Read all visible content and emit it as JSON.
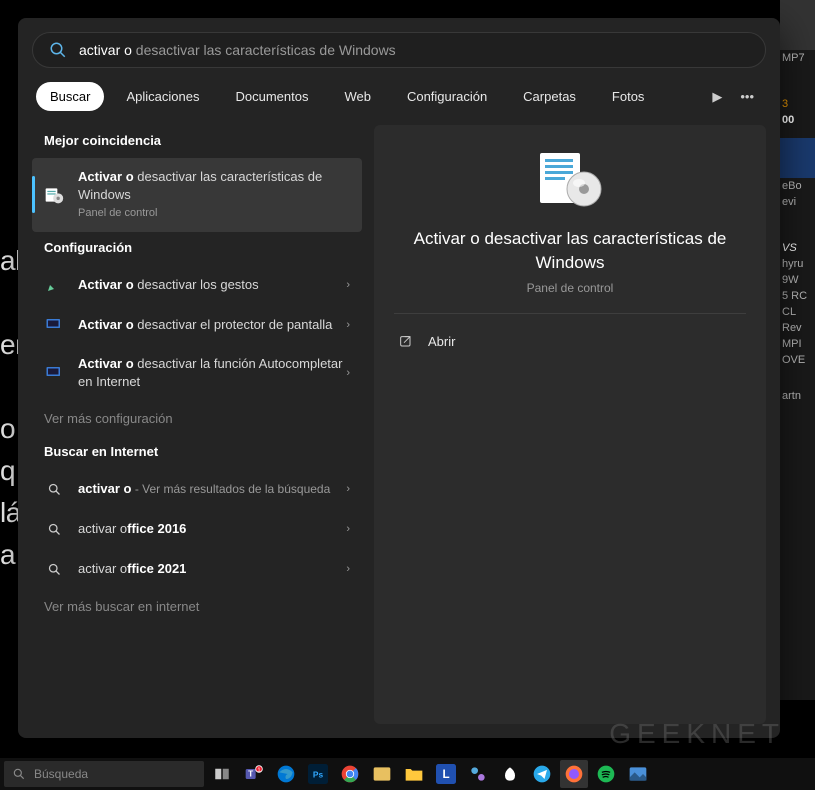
{
  "search": {
    "typed": "activar o",
    "hint": " desactivar las características de Windows"
  },
  "tabs": {
    "items": [
      "Buscar",
      "Aplicaciones",
      "Documentos",
      "Web",
      "Configuración",
      "Carpetas",
      "Fotos"
    ],
    "active": 0
  },
  "sections": {
    "best_match": "Mejor coincidencia",
    "configuration": "Configuración",
    "search_web": "Buscar en Internet"
  },
  "results": {
    "best": {
      "bold": "Activar o ",
      "rest": "desactivar las características de Windows",
      "sub": "Panel de control"
    },
    "config": [
      {
        "bold": "Activar o ",
        "rest": "desactivar los gestos"
      },
      {
        "bold": "Activar o ",
        "rest": "desactivar el protector de pantalla"
      },
      {
        "bold": "Activar o ",
        "rest": "desactivar la función Autocompletar en Internet"
      }
    ],
    "config_more": "Ver más configuración",
    "web": [
      {
        "bold": "activar o",
        "rest": " - Ver más resultados de la búsqueda"
      },
      {
        "bold": "activar o",
        "rest": "ffice 2016"
      },
      {
        "bold": "activar o",
        "rest": "ffice 2021"
      }
    ],
    "web_more": "Ver más buscar en internet"
  },
  "preview": {
    "title": "Activar o desactivar las características de Windows",
    "sub": "Panel de control",
    "action_open": "Abrir"
  },
  "taskbar": {
    "search_placeholder": "Búsqueda"
  },
  "bg": {
    "side": [
      "MP7",
      "3",
      "00",
      "eBo",
      "evi",
      "VS",
      "hyru",
      "9W",
      "5 RC",
      "CL",
      "Rev",
      "MPI",
      "OVE",
      "artn"
    ],
    "left": "ab\n\nem\n\no\nq\nlá\na"
  },
  "watermark": "GEEKNET"
}
